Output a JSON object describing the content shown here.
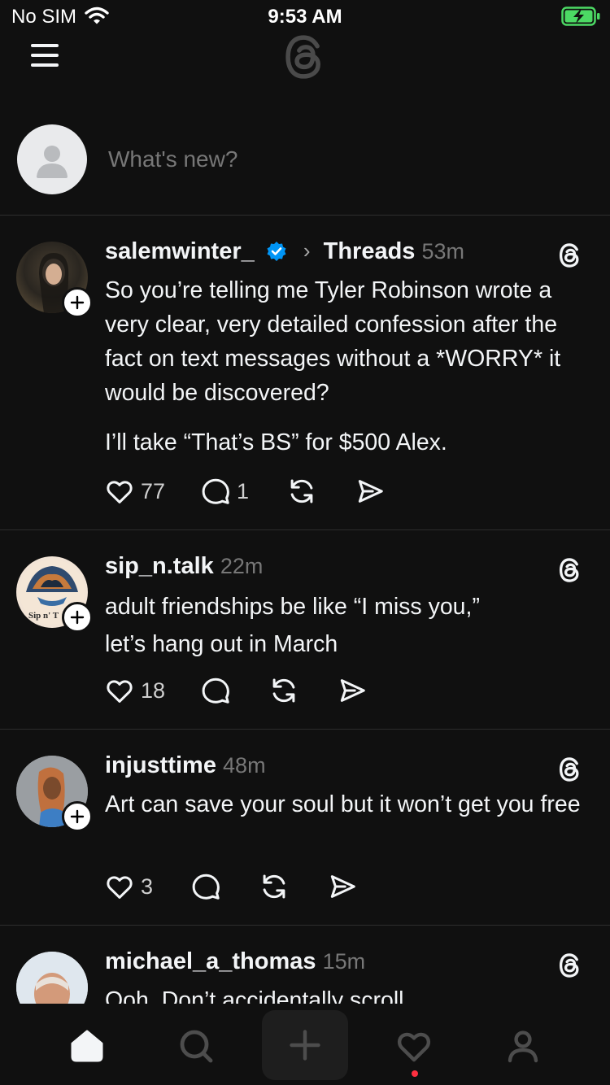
{
  "status_bar": {
    "carrier": "No SIM",
    "time": "9:53 AM"
  },
  "header": {
    "menu_icon": "menu-icon",
    "logo_icon": "threads-logo"
  },
  "composer": {
    "placeholder": "What's new?"
  },
  "posts": [
    {
      "username": "salemwinter_",
      "verified": true,
      "topic": "Threads",
      "time": "53m",
      "paragraphs": [
        "So you’re telling me Tyler Robinson wrote a very clear, very detailed confession after the fact on text messages without a *WORRY* it would be discovered?",
        "I’ll take “That’s BS” for $500 Alex."
      ],
      "likes": "77",
      "replies": "1",
      "reposts": "",
      "shares": ""
    },
    {
      "username": "sip_n.talk",
      "time": "22m",
      "paragraphs": [
        "adult friendships be like “I miss you,” let’s hang out in March"
      ],
      "avatar_text": "Sip n' T",
      "likes": "18",
      "replies": "",
      "reposts": "",
      "shares": ""
    },
    {
      "username": "injusttime",
      "time": "48m",
      "paragraphs": [
        "Art can save your soul but it won’t get you free"
      ],
      "likes": "3",
      "replies": "",
      "reposts": "",
      "shares": ""
    },
    {
      "username": "michael_a_thomas",
      "time": "15m",
      "paragraphs": [
        "Ooh. Don’t accidentally scroll"
      ]
    }
  ],
  "tab_bar": {
    "items": [
      "home-icon",
      "search-icon",
      "compose-icon",
      "activity-icon",
      "profile-icon"
    ],
    "accent": "#ff3040"
  },
  "colors": {
    "background": "#101010",
    "text": "#f3f5f7",
    "muted": "#777777",
    "verified": "#0095f6"
  }
}
